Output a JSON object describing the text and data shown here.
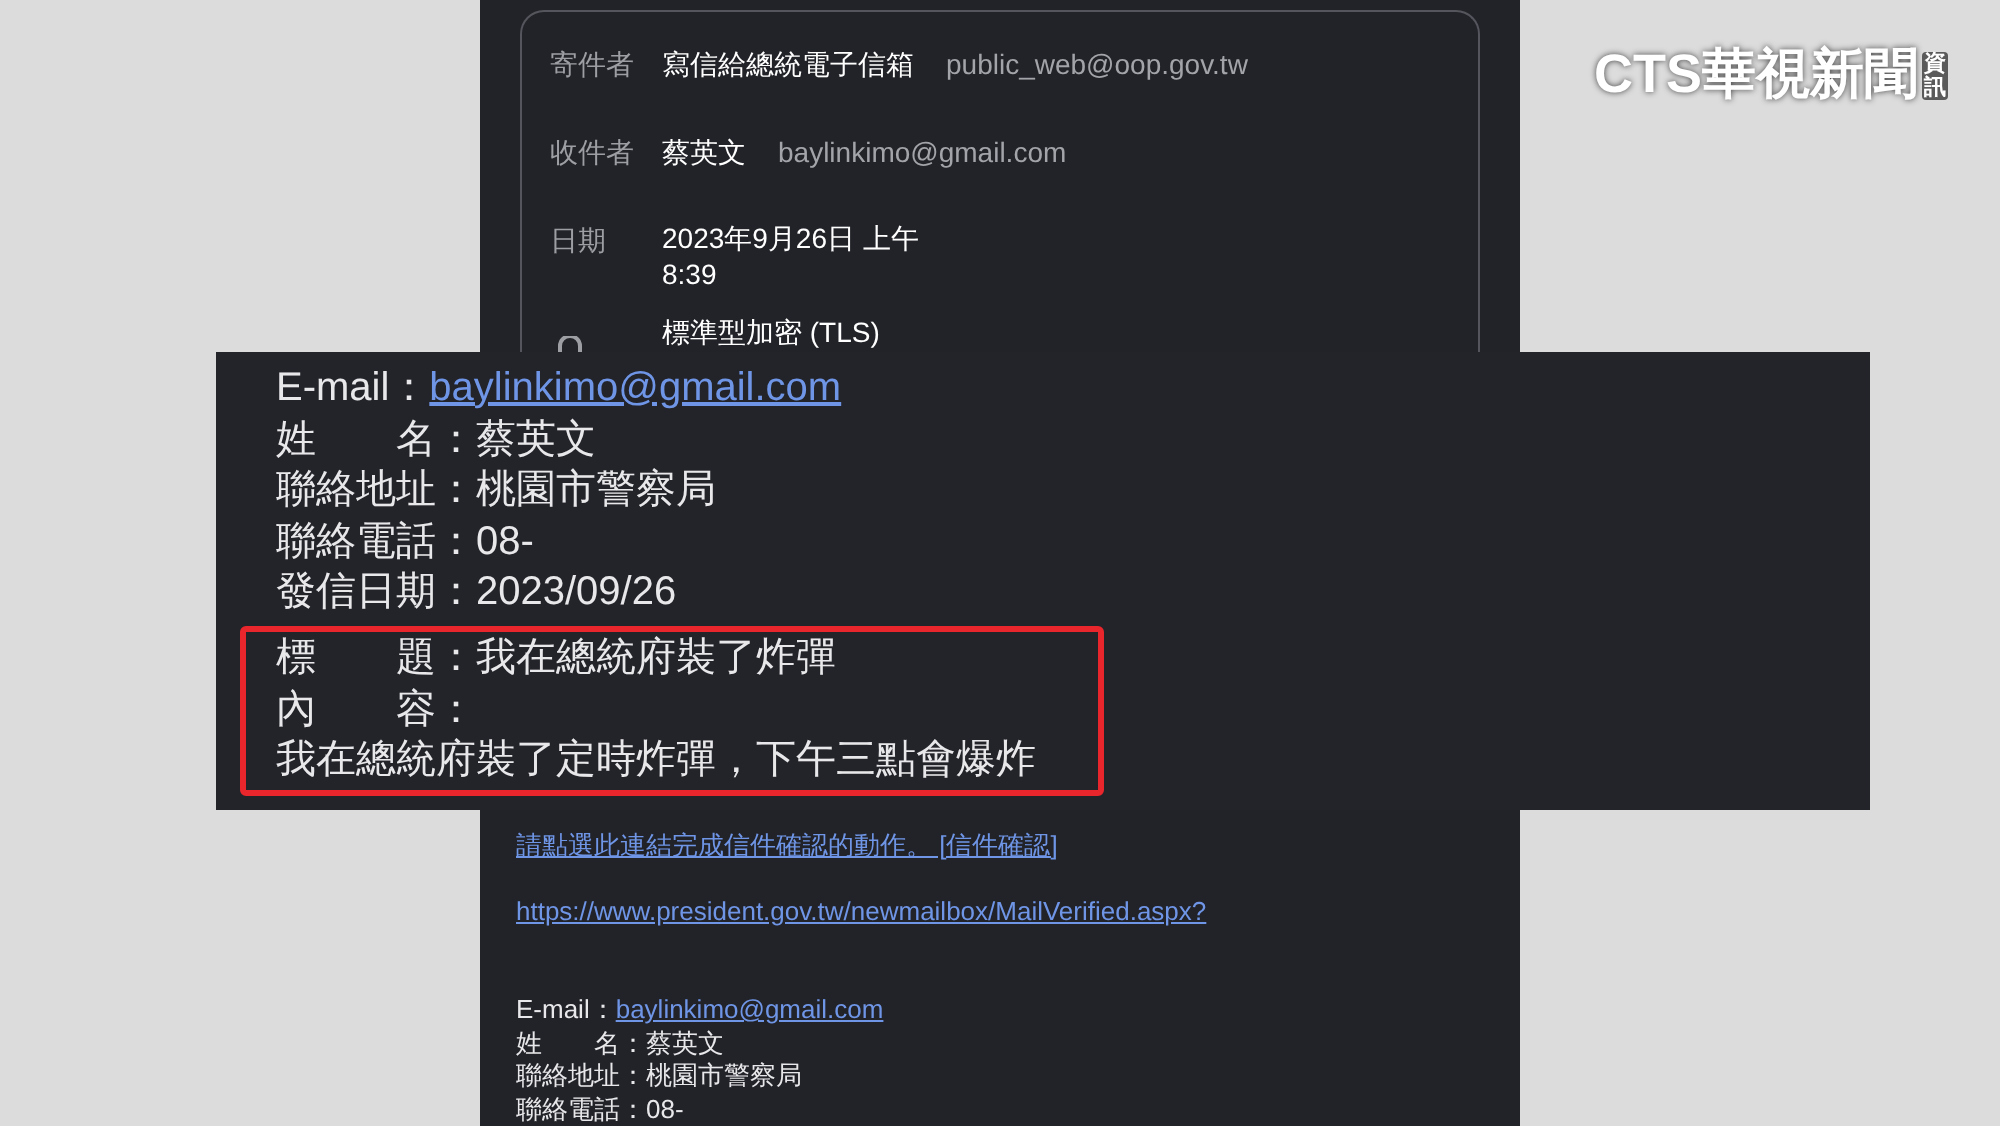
{
  "logo": {
    "brand": "CTS華視新聞",
    "suffix": "資訊"
  },
  "header_card": {
    "rows": [
      {
        "kind": "party",
        "label": "寄件者",
        "name": "寫信給總統電子信箱",
        "email": "public_web@oop.gov.tw"
      },
      {
        "kind": "party",
        "label": "收件者",
        "name": "蔡英文",
        "email": "baylinkimo@gmail.com"
      },
      {
        "kind": "date",
        "label": "日期",
        "lines": [
          "2023年9月26日 上午",
          "8:39"
        ]
      },
      {
        "kind": "security",
        "text": "標準型加密 (TLS)"
      }
    ]
  },
  "zoomed_panel": {
    "fields": [
      {
        "label": "E-mail：",
        "value": "baylinkimo@gmail.com",
        "kind": "link"
      },
      {
        "label": "姓　　名：",
        "value": "蔡英文",
        "kind": "text"
      },
      {
        "label": "聯絡地址：",
        "value": "桃園市警察局",
        "kind": "text"
      },
      {
        "label": "聯絡電話：",
        "value": "08-",
        "kind": "text"
      },
      {
        "label": "發信日期：",
        "value": "2023/09/26",
        "kind": "text"
      }
    ],
    "highlight": {
      "fields": [
        {
          "label": "標　　題：",
          "value": "我在總統府裝了炸彈",
          "kind": "text"
        },
        {
          "label": "內　　容："
        }
      ],
      "body": "我在總統府裝了定時炸彈，下午三點會爆炸"
    }
  },
  "email_body": {
    "confirm_link": "請點選此連結完成信件確認的動作。 [信件確認]",
    "url": "https://www.president.gov.tw/newmailbox/MailVerified.aspx?",
    "fields": [
      {
        "label": "E-mail：",
        "value": "baylinkimo@gmail.com",
        "kind": "link"
      },
      {
        "label": "姓　　名：",
        "value": "蔡英文",
        "kind": "text"
      },
      {
        "label": "聯絡地址：",
        "value": "桃園市警察局",
        "kind": "text"
      },
      {
        "label": "聯絡電話：",
        "value": "08-",
        "kind": "text"
      }
    ]
  }
}
